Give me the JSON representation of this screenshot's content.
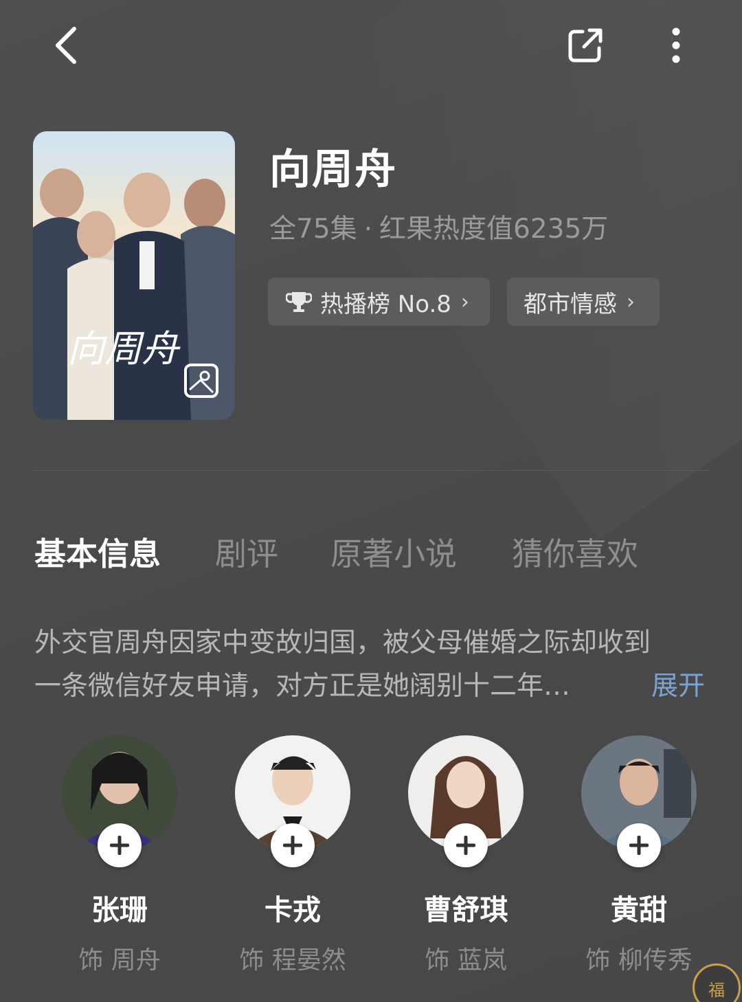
{
  "header": {
    "back_icon": "chevron-left-icon",
    "share_icon": "share-icon",
    "more_icon": "more-vertical-icon"
  },
  "show": {
    "title": "向周舟",
    "episodes": "全75集",
    "separator": "·",
    "heat": "红果热度值6235万",
    "rank_tag": "热播榜 No.8",
    "genre_tag": "都市情感",
    "poster_title_art": "向周舟"
  },
  "tabs": [
    {
      "label": "基本信息",
      "active": true
    },
    {
      "label": "剧评",
      "active": false
    },
    {
      "label": "原著小说",
      "active": false
    },
    {
      "label": "猜你喜欢",
      "active": false
    }
  ],
  "synopsis": {
    "line1": "外交官周舟因家中变故归国，被父母催婚之际却收到",
    "line2": "一条微信好友申请，对方正是她阔别十二年…",
    "expand_label": "展开"
  },
  "cast": [
    {
      "name": "张珊",
      "role": "饰 周舟"
    },
    {
      "name": "卡戎",
      "role": "饰 程晏然"
    },
    {
      "name": "曹舒琪",
      "role": "饰 蓝岚"
    },
    {
      "name": "黄甜",
      "role": "饰 柳传秀"
    }
  ],
  "floating": {
    "label": "福"
  },
  "colors": {
    "background": "#4a4a4a",
    "accent_link": "#7ea2cf",
    "tag_bg": "#5c5c5c"
  }
}
